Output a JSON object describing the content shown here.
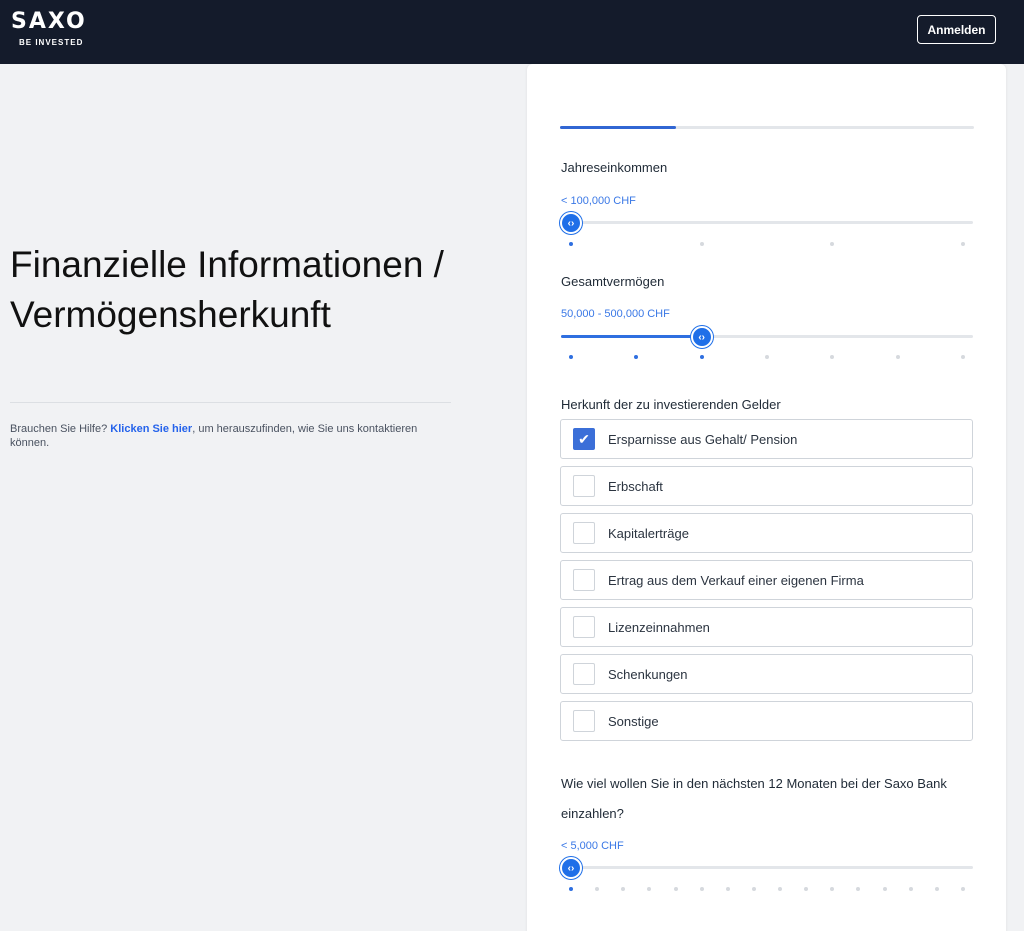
{
  "header": {
    "logo_main": "SAXO",
    "logo_sub": "BE INVESTED",
    "login_label": "Anmelden"
  },
  "left": {
    "title": "Finanzielle Informationen / Vermögensherkunft",
    "help_prefix": "Brauchen Sie Hilfe? ",
    "help_link": "Klicken Sie hier",
    "help_suffix": ", um herauszufinden, wie Sie uns kontaktieren können."
  },
  "form": {
    "progress_fraction": 0.28,
    "annual_income": {
      "label": "Jahreseinkommen",
      "value": "< 100,000 CHF",
      "steps": 4,
      "selected_index": 0
    },
    "total_assets": {
      "label": "Gesamtvermögen",
      "value": "50,000 - 500,000 CHF",
      "steps": 7,
      "selected_index": 2
    },
    "funds_origin": {
      "label": "Herkunft der zu investierenden Gelder",
      "options": [
        {
          "label": "Ersparnisse aus Gehalt/ Pension",
          "checked": true
        },
        {
          "label": "Erbschaft",
          "checked": false
        },
        {
          "label": "Kapitalerträge",
          "checked": false
        },
        {
          "label": "Ertrag aus dem Verkauf einer eigenen Firma",
          "checked": false
        },
        {
          "label": "Lizenzeinnahmen",
          "checked": false
        },
        {
          "label": "Schenkungen",
          "checked": false
        },
        {
          "label": "Sonstige",
          "checked": false
        }
      ]
    },
    "deposit": {
      "label": "Wie viel wollen Sie in den nächsten 12 Monaten bei der Saxo Bank einzahlen?",
      "value": "< 5,000 CHF",
      "steps": 16,
      "selected_index": 0
    }
  },
  "colors": {
    "accent": "#2f6fe0",
    "header_bg": "#141b2b",
    "link": "#2563eb"
  }
}
